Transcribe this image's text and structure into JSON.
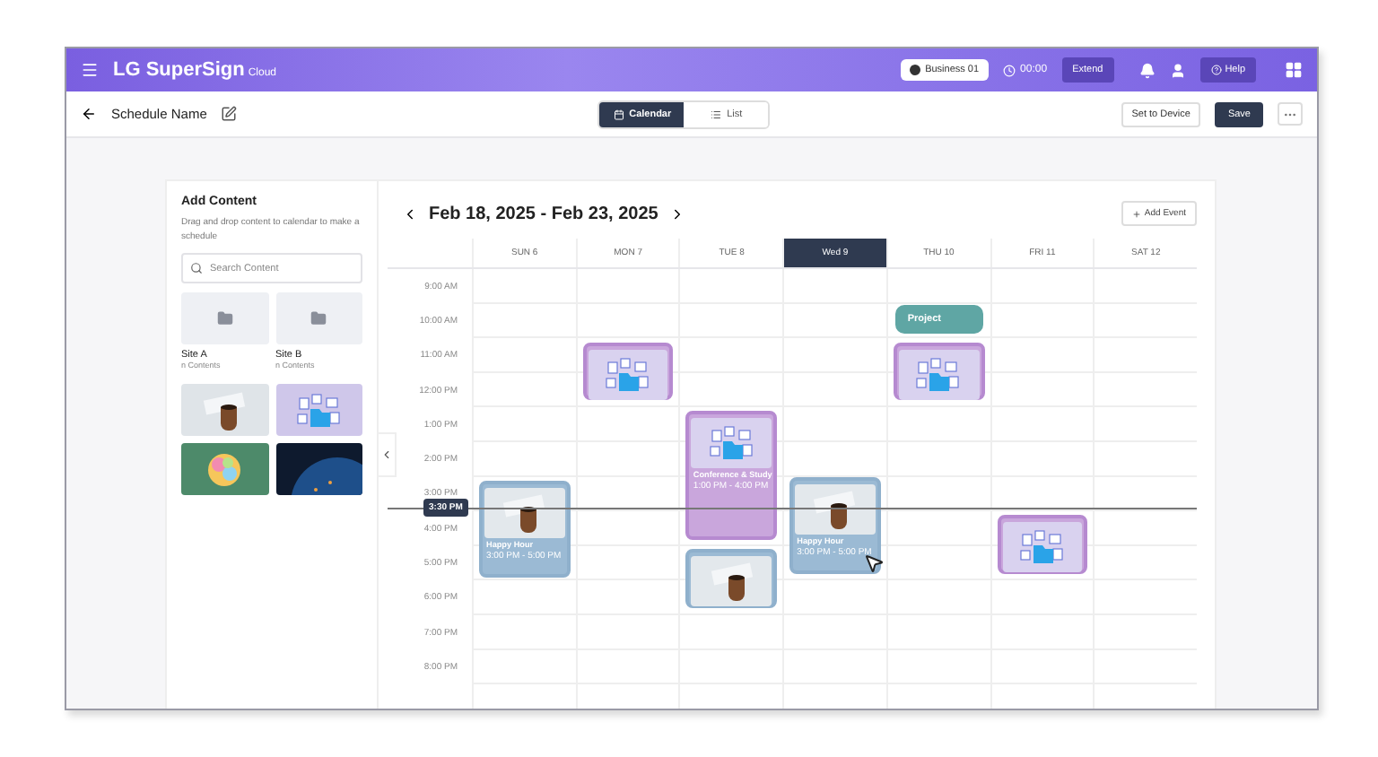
{
  "topbar": {
    "brand": "LG SuperSign",
    "brand_suffix": "Cloud",
    "workspace": "Business 01",
    "timer": "00:00",
    "extend": "Extend",
    "help": "Help"
  },
  "header": {
    "title": "Schedule Name",
    "views": [
      {
        "label": "Calendar",
        "selected": true
      },
      {
        "label": "List",
        "selected": false
      }
    ],
    "actions": [
      "Set to Device",
      "Save"
    ]
  },
  "sidebar": {
    "title": "Add Content",
    "description": "Drag and drop content to calendar to make a schedule",
    "search": {
      "placeholder": "Search Content"
    },
    "folders": [
      {
        "name": "Site A",
        "count": "n Contents"
      },
      {
        "name": "Site B",
        "count": "n Contents"
      }
    ],
    "media": [
      {
        "kind": "coffee"
      },
      {
        "kind": "files"
      },
      {
        "kind": "sticky"
      },
      {
        "kind": "earth"
      }
    ]
  },
  "calendar": {
    "range": "Feb 18, 2025 - Feb 23, 2025",
    "add_event": "Add Event",
    "now": "3:30 PM",
    "times": [
      "9:00 AM",
      "10:00 AM",
      "11:00 AM",
      "12:00 PM",
      "1:00 PM",
      "2:00 PM",
      "3:00 PM",
      "4:00 PM",
      "5:00 PM",
      "6:00 PM",
      "7:00 PM",
      "8:00 PM"
    ],
    "days": [
      {
        "label": "SUN 6",
        "selected": false,
        "events": [
          {
            "kind": "coffee",
            "title": "Happy Hour",
            "time": "3:00 PM - 5:00 PM"
          }
        ]
      },
      {
        "label": "MON 7",
        "selected": false,
        "events": [
          {
            "kind": "files"
          }
        ]
      },
      {
        "label": "TUE 8",
        "selected": false,
        "events": [
          {
            "kind": "files",
            "title": "Conference & Study",
            "time": "1:00 PM - 4:00 PM"
          },
          {
            "kind": "coffee"
          }
        ]
      },
      {
        "label": "Wed 9",
        "selected": true,
        "events": [
          {
            "kind": "coffee",
            "title": "Happy Hour",
            "time": "3:00 PM - 5:00 PM"
          }
        ]
      },
      {
        "label": "THU 10",
        "selected": false,
        "events": [
          {
            "kind": "label",
            "title": "Project"
          },
          {
            "kind": "files"
          }
        ]
      },
      {
        "label": "FRI 11",
        "selected": false,
        "events": [
          {
            "kind": "files"
          }
        ]
      },
      {
        "label": "SAT 12",
        "selected": false
      }
    ]
  }
}
